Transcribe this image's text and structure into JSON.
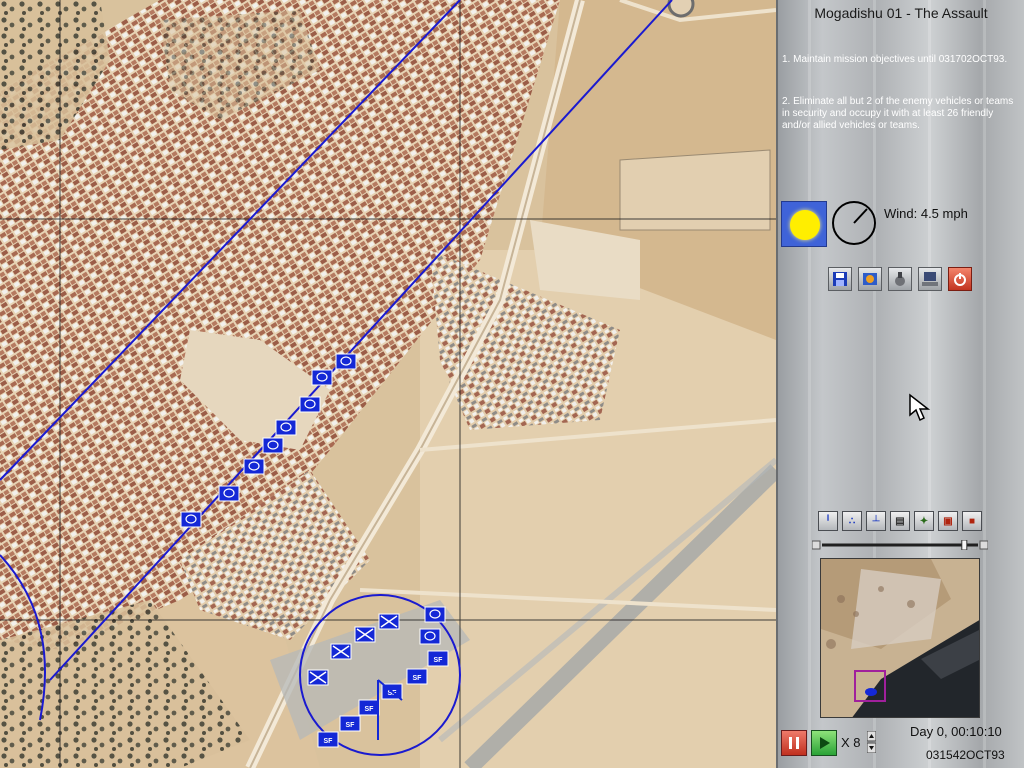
{
  "mission": {
    "title": "Mogadishu 01 - The Assault",
    "objective_1": "1. Maintain mission objectives until 031702OCT93.",
    "objective_2": "2. Eliminate all but 2 of the enemy vehicles or teams in security and occupy it with at least 26 friendly and/or allied vehicles or teams."
  },
  "weather": {
    "condition_icon": "sun-icon",
    "wind_label": "Wind: 4.5 mph"
  },
  "toolbar": {
    "save_icon": "save-icon",
    "map_icon": "map-settings-icon",
    "tools_icon": "tools-icon",
    "computer_icon": "computer-icon",
    "power_icon": "power-icon"
  },
  "unit_toolbar": {
    "icons": [
      "squad-icon",
      "platoon-icon",
      "company-icon",
      "report-icon",
      "map-tools-icon",
      "exit-unit-icon",
      "stop-icon"
    ]
  },
  "zoom": {
    "level": 0.92
  },
  "clock": {
    "day_time": "Day 0, 00:10:10",
    "datetime": "031542OCT93"
  },
  "playback": {
    "speed_label": "X 8"
  },
  "map": {
    "unit_label": "SF",
    "accent_blue": "#1428d6",
    "minimap_highlight": "#a0209c"
  }
}
